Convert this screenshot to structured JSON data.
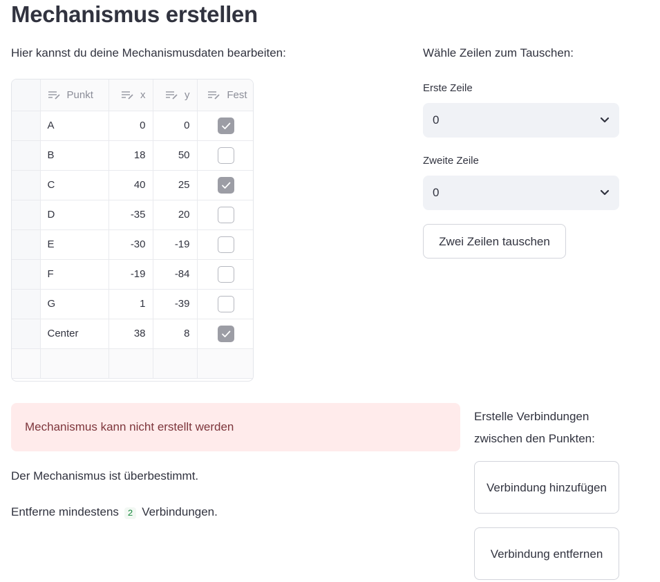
{
  "page": {
    "title": "Mechanismus erstellen",
    "caption": "Hier kannst du deine Mechanismusdaten bearbeiten:"
  },
  "table": {
    "columns": [
      "Punkt",
      "x",
      "y",
      "Fest"
    ],
    "rows": [
      {
        "punkt": "A",
        "x": "0",
        "y": "0",
        "fest": true
      },
      {
        "punkt": "B",
        "x": "18",
        "y": "50",
        "fest": false
      },
      {
        "punkt": "C",
        "x": "40",
        "y": "25",
        "fest": true
      },
      {
        "punkt": "D",
        "x": "-35",
        "y": "20",
        "fest": false
      },
      {
        "punkt": "E",
        "x": "-30",
        "y": "-19",
        "fest": false
      },
      {
        "punkt": "F",
        "x": "-19",
        "y": "-84",
        "fest": false
      },
      {
        "punkt": "G",
        "x": "1",
        "y": "-39",
        "fest": false
      },
      {
        "punkt": "Center",
        "x": "38",
        "y": "8",
        "fest": true
      }
    ]
  },
  "swap": {
    "caption": "Wähle Zeilen zum Tauschen:",
    "first_label": "Erste Zeile",
    "first_value": "0",
    "second_label": "Zweite Zeile",
    "second_value": "0",
    "button_label": "Zwei Zeilen tauschen"
  },
  "status": {
    "error": "Mechanismus kann nicht erstellt werden",
    "message1": "Der Mechanismus ist überbestimmt.",
    "message2_prefix": "Entferne mindestens",
    "message2_count": "2",
    "message2_suffix": "Verbindungen."
  },
  "connections": {
    "caption": "Erstelle Verbindungen zwischen den Punkten:",
    "add_label": "Verbindung hinzufügen",
    "remove_label": "Verbindung entfernen"
  },
  "colors": {
    "error_bg": "#ffebeb",
    "error_text": "#7d353b",
    "code_text": "#178a3d",
    "checked_box": "#9c9da5",
    "select_bg": "#f0f2f6"
  },
  "icons": {
    "column_header": "edit-column-icon",
    "select": "chevron-down-icon",
    "checkbox": "check-icon"
  }
}
